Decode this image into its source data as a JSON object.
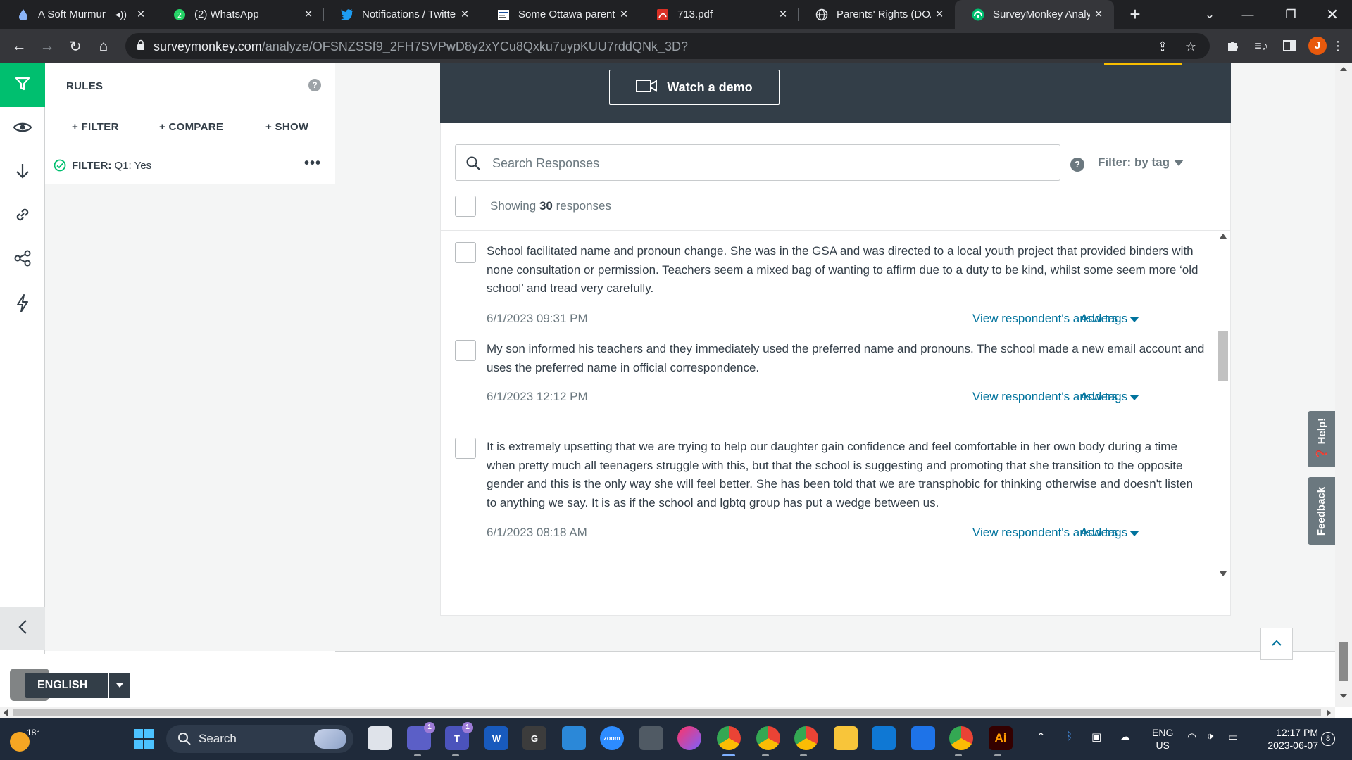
{
  "browser": {
    "tabs": [
      {
        "title": "A Soft Murmur",
        "icon": "water-drop-icon",
        "audio": true
      },
      {
        "title": "(2) WhatsApp",
        "icon": "whatsapp-icon"
      },
      {
        "title": "Notifications / Twitter",
        "icon": "twitter-icon"
      },
      {
        "title": "Some Ottawa parents",
        "icon": "news-icon"
      },
      {
        "title": "713.pdf",
        "icon": "pdf-icon"
      },
      {
        "title": "Parents' Rights (DOA)",
        "icon": "globe-icon"
      },
      {
        "title": "SurveyMonkey Analyz",
        "icon": "surveymonkey-icon",
        "active": true
      }
    ],
    "new_tab": "+",
    "url_host": "surveymonkey.com",
    "url_path": "/analyze/OFSNZSSf9_2FH7SVPwD8y2xYCu8Qxku7uypKUU7rddQNk_3D?",
    "profile_initial": "J"
  },
  "sidebar_rail": {
    "items": [
      "filter-icon",
      "eye-icon",
      "download-icon",
      "link-icon",
      "share-icon",
      "lightning-icon"
    ],
    "collapse": "‹"
  },
  "rules": {
    "title": "RULES",
    "help": "?",
    "actions": {
      "filter": "+ FILTER",
      "compare": "+ COMPARE",
      "show": "+ SHOW"
    },
    "filter_label": "FILTER:",
    "filter_value": " Q1: Yes",
    "more": "•••"
  },
  "banner": {
    "demo_label": "Watch a demo"
  },
  "responses": {
    "search_placeholder": "Search Responses",
    "filter_help": "?",
    "filter_by_tag": "Filter: by tag",
    "showing_prefix": "Showing ",
    "showing_count": "30",
    "showing_suffix": " responses",
    "view_label": "View respondent's answers",
    "tags_label": "Add tags",
    "items": [
      {
        "text": "School facilitated name and pronoun change. She was in the GSA and was directed to a local youth project that provided binders with none consultation or permission. Teachers seem a mixed bag of wanting to affirm due to a duty to be kind, whilst some seem more ‘old school’ and tread very carefully.",
        "date": "6/1/2023 09:31 PM"
      },
      {
        "text": "My son informed his teachers and they immediately used the preferred name and pronouns. The school made a new email account and uses the preferred name in official correspondence.",
        "date": "6/1/2023 12:12 PM"
      },
      {
        "text": "It is extremely upsetting that we are trying to help our daughter gain confidence and feel comfortable in her own body during a time when pretty much all teenagers struggle with this, but that the school is suggesting and promoting that she transition to the opposite gender and this is the only way she will feel better. She has been told that we are transphobic for thinking otherwise and doesn't listen to anything we say. It is as if the school and lgbtq group has put a wedge between us.",
        "date": "6/1/2023 08:18 AM"
      }
    ]
  },
  "side_tabs": {
    "help": "Help!",
    "feedback": "Feedback"
  },
  "language": {
    "label": "ENGLISH"
  },
  "taskbar": {
    "weather_temp": "18°",
    "search_label": "Search",
    "lang_top": "ENG",
    "lang_bottom": "US",
    "time": "12:17 PM",
    "date": "2023-06-07",
    "notifications": "8",
    "apps": [
      {
        "name": "file-explorer-window-icon",
        "label": ""
      },
      {
        "name": "teams-icon",
        "badge": "1"
      },
      {
        "name": "teams-chat-icon",
        "badge": "1"
      },
      {
        "name": "word-icon",
        "label": "W"
      },
      {
        "name": "app-g-icon",
        "label": "G"
      },
      {
        "name": "calculator-grid-icon",
        "label": ""
      },
      {
        "name": "zoom-icon",
        "label": "zoom"
      },
      {
        "name": "calculator-icon",
        "label": ""
      },
      {
        "name": "creative-cloud-icon",
        "label": ""
      },
      {
        "name": "chrome-icon",
        "label": ""
      },
      {
        "name": "chrome-profile-2-icon",
        "label": ""
      },
      {
        "name": "chrome-profile-3-icon",
        "label": ""
      },
      {
        "name": "folder-icon",
        "label": ""
      },
      {
        "name": "mail-icon",
        "label": ""
      },
      {
        "name": "calendar-icon",
        "label": ""
      },
      {
        "name": "chrome-profile-4-icon",
        "label": ""
      },
      {
        "name": "illustrator-icon",
        "label": "Ai"
      }
    ]
  },
  "colors": {
    "accent_green": "#00bf6f",
    "link_blue": "#00739d",
    "banner_dark": "#333e48",
    "banner_yellow": "#f9be00"
  }
}
